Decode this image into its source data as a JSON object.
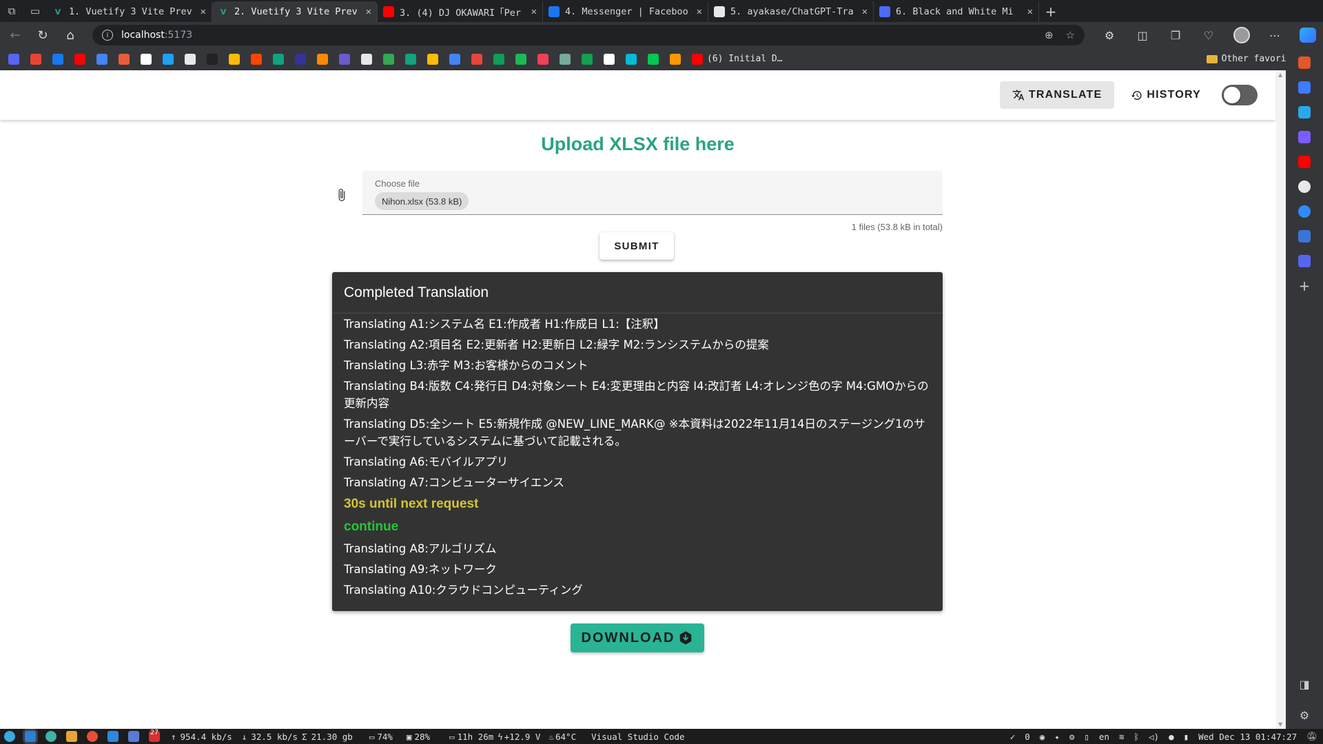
{
  "browser": {
    "tabs": [
      {
        "title": "1. Vuetify 3 Vite Prev",
        "favicon": "vuetify-icon",
        "color": "#1ba783"
      },
      {
        "title": "2. Vuetify 3 Vite Prev",
        "favicon": "vuetify-icon",
        "color": "#1ba783",
        "active": true
      },
      {
        "title": "3. (4) DJ OKAWARI「Per",
        "favicon": "youtube-icon",
        "color": "#ff0000"
      },
      {
        "title": "4. Messenger | Faceboo",
        "favicon": "facebook-icon",
        "color": "#1877f2"
      },
      {
        "title": "5. ayakase/ChatGPT-Tra",
        "favicon": "github-icon",
        "color": "#e8e8e8"
      },
      {
        "title": "6. Black and White Mi",
        "favicon": "document-icon",
        "color": "#4a6cf7"
      }
    ],
    "address": {
      "host": "localhost",
      "port": ":5173"
    },
    "bookmarks": [
      {
        "icon": "discord-icon",
        "color": "#5865f2"
      },
      {
        "icon": "gmail-icon",
        "color": "#ea4335"
      },
      {
        "icon": "facebook-icon",
        "color": "#1877f2"
      },
      {
        "icon": "youtube-icon",
        "color": "#ff0000"
      },
      {
        "icon": "translate-icon",
        "color": "#4285f4"
      },
      {
        "icon": "shopping-icon",
        "color": "#e85d3a"
      },
      {
        "icon": "x-icon",
        "color": "#ffffff"
      },
      {
        "icon": "p-icon",
        "color": "#1da1f2"
      },
      {
        "icon": "notion-like-icon",
        "color": "#e8e8e8"
      },
      {
        "icon": "app-icon",
        "color": "#222222"
      },
      {
        "icon": "keep-icon",
        "color": "#fbbc04"
      },
      {
        "icon": "reddit-icon",
        "color": "#ff4500"
      },
      {
        "icon": "openai-icon",
        "color": "#10a37f"
      },
      {
        "icon": "circle-icon",
        "color": "#333399"
      },
      {
        "icon": "dots-icon",
        "color": "#ff8800"
      },
      {
        "icon": "window-icon",
        "color": "#6a5acd"
      },
      {
        "icon": "github-icon",
        "color": "#e8e8e8"
      },
      {
        "icon": "maps-icon",
        "color": "#34a853"
      },
      {
        "icon": "chatgpt-icon",
        "color": "#10a37f"
      },
      {
        "icon": "drive-icon",
        "color": "#fbbc04"
      },
      {
        "icon": "docs-icon",
        "color": "#4285f4"
      },
      {
        "icon": "mail-icon",
        "color": "#e8453c"
      },
      {
        "icon": "sheets-icon",
        "color": "#0f9d58"
      },
      {
        "icon": "spotify-icon",
        "color": "#1db954"
      },
      {
        "icon": "pocket-icon",
        "color": "#ef4056"
      },
      {
        "icon": "openai-icon",
        "color": "#74aa9c"
      },
      {
        "icon": "medium-icon",
        "color": "#12a150"
      },
      {
        "icon": "notion-icon",
        "color": "#ffffff"
      },
      {
        "icon": "sparkle-icon",
        "color": "#00bcd4"
      },
      {
        "icon": "box-icon",
        "color": "#00c853"
      },
      {
        "icon": "warning-icon",
        "color": "#ff9800"
      },
      {
        "icon": "youtube-icon",
        "color": "#ff0000"
      }
    ],
    "bookmark_last_label": "(6) Initial D…",
    "bookmark_folder": "Other favorites"
  },
  "app": {
    "nav": {
      "translate_label": "TRANSLATE",
      "history_label": "HISTORY"
    },
    "upload_title": "Upload XLSX file here",
    "file_input": {
      "label": "Choose file",
      "chip": "Nihon.xlsx (53.8 kB)",
      "counter": "1 files (53.8 kB in total)"
    },
    "submit_label": "SUBMIT",
    "results": {
      "title": "Completed Translation",
      "lines_before_wait": [
        "Translating A1:システム名 E1:作成者 H1:作成日 L1:【注釈】",
        "Translating A2:項目名 E2:更新者 H2:更新日 L2:緑字 M2:ランシステムからの提案",
        "Translating L3:赤字 M3:お客様からのコメント",
        "Translating B4:版数 C4:発行日 D4:対象シート E4:変更理由と内容 I4:改訂者 L4:オレンジ色の字 M4:GMOからの更新内容",
        "Translating D5:全シート E5:新規作成 @NEW_LINE_MARK@ ※本資料は2022年11月14日のステージング1のサーバーで実行しているシステムに基づいて記載される。",
        "Translating A6:モバイルアプリ",
        "Translating A7:コンピューターサイエンス"
      ],
      "wait_message": "30s until next request",
      "continue_message": "continue",
      "lines_after_wait": [
        "Translating A8:アルゴリズム",
        "Translating A9:ネットワーク",
        "Translating A10:クラウドコンピューティング"
      ]
    },
    "download_label": "DOWNLOAD",
    "colors": {
      "accent": "#29a383",
      "download": "#29b495",
      "wait": "#d5c436",
      "continue": "#22c734",
      "card": "#333333"
    }
  },
  "taskbar": {
    "stats": [
      "954.4 kb/s",
      "32.5 kb/s",
      "21.30 gb",
      "74%",
      "28%",
      "11h 26m",
      "+12.9 V",
      "64°C",
      "Visual Studio Code"
    ],
    "badge": "27",
    "tray": {
      "count": "0",
      "lang": "en",
      "datetime": "Wed Dec 13 01:47:27"
    }
  }
}
